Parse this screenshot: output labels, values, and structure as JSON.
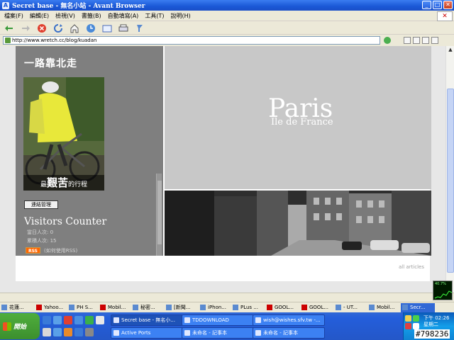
{
  "window": {
    "title": "Secret base - 無名小站 - Avant Browser",
    "app_icon_letter": "A",
    "controls": {
      "minimize": "_",
      "maximize": "□",
      "close": "✕"
    }
  },
  "menu": [
    "檔案(F)",
    "編輯(E)",
    "檢視(V)",
    "書籤(B)",
    "自動填寫(A)",
    "工具(T)",
    "說明(H)"
  ],
  "toolbar": [
    "back-icon",
    "forward-icon",
    "stop-icon",
    "refresh-icon",
    "home-icon",
    "history-icon",
    "favorites-icon",
    "print-icon",
    "popup-blocker-icon"
  ],
  "address": {
    "url": "http://www.wretch.cc/blog/kuadan"
  },
  "page": {
    "blog_title": "一路靠北走",
    "photo_caption_prefix": "最",
    "photo_caption_big": "艱苦",
    "photo_caption_suffix": "的行程",
    "manage_button": "連結管理",
    "visitors_title": "Visitors Counter",
    "today_label": "當日人次: 0",
    "total_label": "累積人次: 15",
    "rss_badge": "RSS",
    "rss_text": "(如何使用RSS)",
    "hero_title": "Paris",
    "hero_subtitle": "Ile de France",
    "all_articles": "all articles"
  },
  "netmon": {
    "label": "40.7%"
  },
  "tabs": [
    {
      "label": "花蓮...",
      "icon": "page-icon"
    },
    {
      "label": "Yahoo...",
      "icon": "yahoo-icon"
    },
    {
      "label": "PH S...",
      "icon": "page-icon"
    },
    {
      "label": "Mobil...",
      "icon": "yahoo-icon"
    },
    {
      "label": "秘密...",
      "icon": "page-icon"
    },
    {
      "label": "[新聞...",
      "icon": "page-icon"
    },
    {
      "label": "iPhon...",
      "icon": "page-icon"
    },
    {
      "label": "PLus ...",
      "icon": "page-icon"
    },
    {
      "label": "GOOL...",
      "icon": "yahoo-icon"
    },
    {
      "label": "GOOL...",
      "icon": "yahoo-icon"
    },
    {
      "label": "- UT...",
      "icon": "page-icon"
    },
    {
      "label": "Mobil...",
      "icon": "page-icon"
    },
    {
      "label": "Secr...",
      "icon": "page-icon",
      "active": true
    }
  ],
  "taskbar": {
    "start": "開始",
    "tasks": [
      {
        "label": "Secret base - 無名小...",
        "pressed": true
      },
      {
        "label": "TDDOWNLOAD"
      },
      {
        "label": "wish@wishes.sfv.tw -..."
      },
      {
        "label": "Active Ports"
      },
      {
        "label": "未命名 - 記事本"
      },
      {
        "label": "未命名 - 記事本"
      }
    ],
    "clock_time": "下午 02:26",
    "clock_day": "星期二"
  },
  "watermark": "#798236"
}
